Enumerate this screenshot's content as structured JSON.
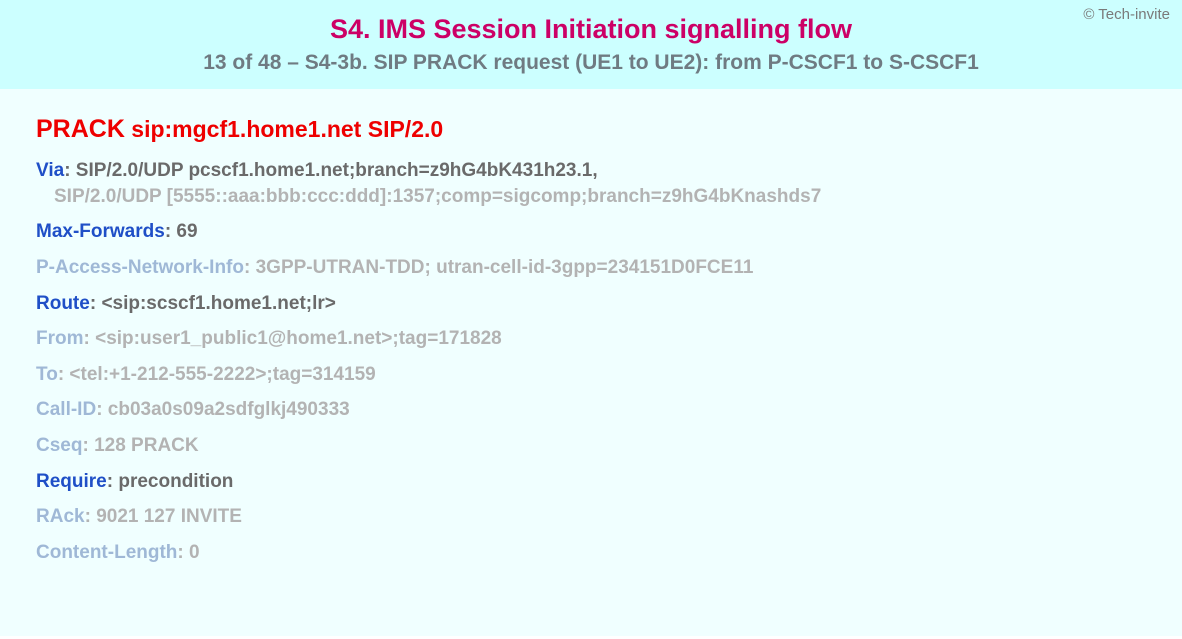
{
  "copyright": "© Tech-invite",
  "title": "S4. IMS Session Initiation signalling flow",
  "subtitle": "13 of 48 – S4-3b. SIP PRACK request (UE1 to UE2): from P-CSCF1 to S-CSCF1",
  "request": {
    "method": "PRACK",
    "uri": "sip:mgcf1.home1.net",
    "version": "SIP/2.0"
  },
  "headers": [
    {
      "name": "Via",
      "value": "SIP/2.0/UDP pcscf1.home1.net;branch=z9hG4bK431h23.1,",
      "muted": false,
      "cont": "SIP/2.0/UDP [5555::aaa:bbb:ccc:ddd]:1357;comp=sigcomp;branch=z9hG4bKnashds7"
    },
    {
      "name": "Max-Forwards",
      "value": "69",
      "muted": false
    },
    {
      "name": "P-Access-Network-Info",
      "value": "3GPP-UTRAN-TDD; utran-cell-id-3gpp=234151D0FCE11",
      "muted": true
    },
    {
      "name": "Route",
      "value": "<sip:scscf1.home1.net;lr>",
      "muted": false
    },
    {
      "name": "From",
      "value": "<sip:user1_public1@home1.net>;tag=171828",
      "muted": true
    },
    {
      "name": "To",
      "value": "<tel:+1-212-555-2222>;tag=314159",
      "muted": true
    },
    {
      "name": "Call-ID",
      "value": "cb03a0s09a2sdfglkj490333",
      "muted": true
    },
    {
      "name": "Cseq",
      "value": "128 PRACK",
      "muted": true
    },
    {
      "name": "Require",
      "value": "precondition",
      "muted": false
    },
    {
      "name": "RAck",
      "value": "9021 127 INVITE",
      "muted": true
    },
    {
      "name": "Content-Length",
      "value": "0",
      "muted": true
    }
  ]
}
